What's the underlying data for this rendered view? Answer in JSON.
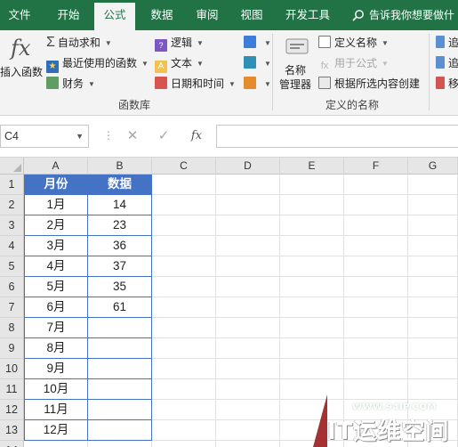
{
  "ribbon_tabs": [
    "文件",
    "开始",
    "公式",
    "数据",
    "审阅",
    "视图",
    "开发工具"
  ],
  "tell_me": "告诉我你想要做什",
  "ribbon": {
    "insert_function": "插入函数",
    "fx_symbol": "fx",
    "autosum": "自动求和",
    "recent": "最近使用的函数",
    "financial": "财务",
    "logical": "逻辑",
    "text": "文本",
    "datetime": "日期和时间",
    "group_library": "函数库",
    "name_manager_line1": "名称",
    "name_manager_line2": "管理器",
    "define_name": "定义名称",
    "use_in_formula": "用于公式",
    "create_from_selection": "根据所选内容创建",
    "group_defined_names": "定义的名称",
    "right_cut_1": "追",
    "right_cut_2": "追",
    "right_cut_3": "移"
  },
  "formula_bar": {
    "name_box": "C4",
    "cancel_symbol": "✕",
    "enter_symbol": "✓",
    "fx_symbol": "fx",
    "value": ""
  },
  "sheet": {
    "columns": [
      "A",
      "B",
      "C",
      "D",
      "E",
      "F",
      "G"
    ],
    "rows": [
      "1",
      "2",
      "3",
      "4",
      "5",
      "6",
      "7",
      "8",
      "9",
      "10",
      "11",
      "12",
      "13",
      "14"
    ],
    "header": [
      "月份",
      "数据"
    ],
    "data": [
      [
        "1月",
        "14"
      ],
      [
        "2月",
        "23"
      ],
      [
        "3月",
        "36"
      ],
      [
        "4月",
        "37"
      ],
      [
        "5月",
        "35"
      ],
      [
        "6月",
        "61"
      ],
      [
        "7月",
        ""
      ],
      [
        "8月",
        ""
      ],
      [
        "9月",
        ""
      ],
      [
        "10月",
        ""
      ],
      [
        "11月",
        ""
      ],
      [
        "12月",
        ""
      ]
    ],
    "active_cell": "C4",
    "table_header_color": "#4472c4"
  },
  "watermark": {
    "url": "WWW.94IP.COM",
    "text": "IT运维空间"
  },
  "colors": {
    "ribbon_green": "#217346",
    "ribbon_bg": "#f3f3f3",
    "table_blue": "#4472c4"
  }
}
